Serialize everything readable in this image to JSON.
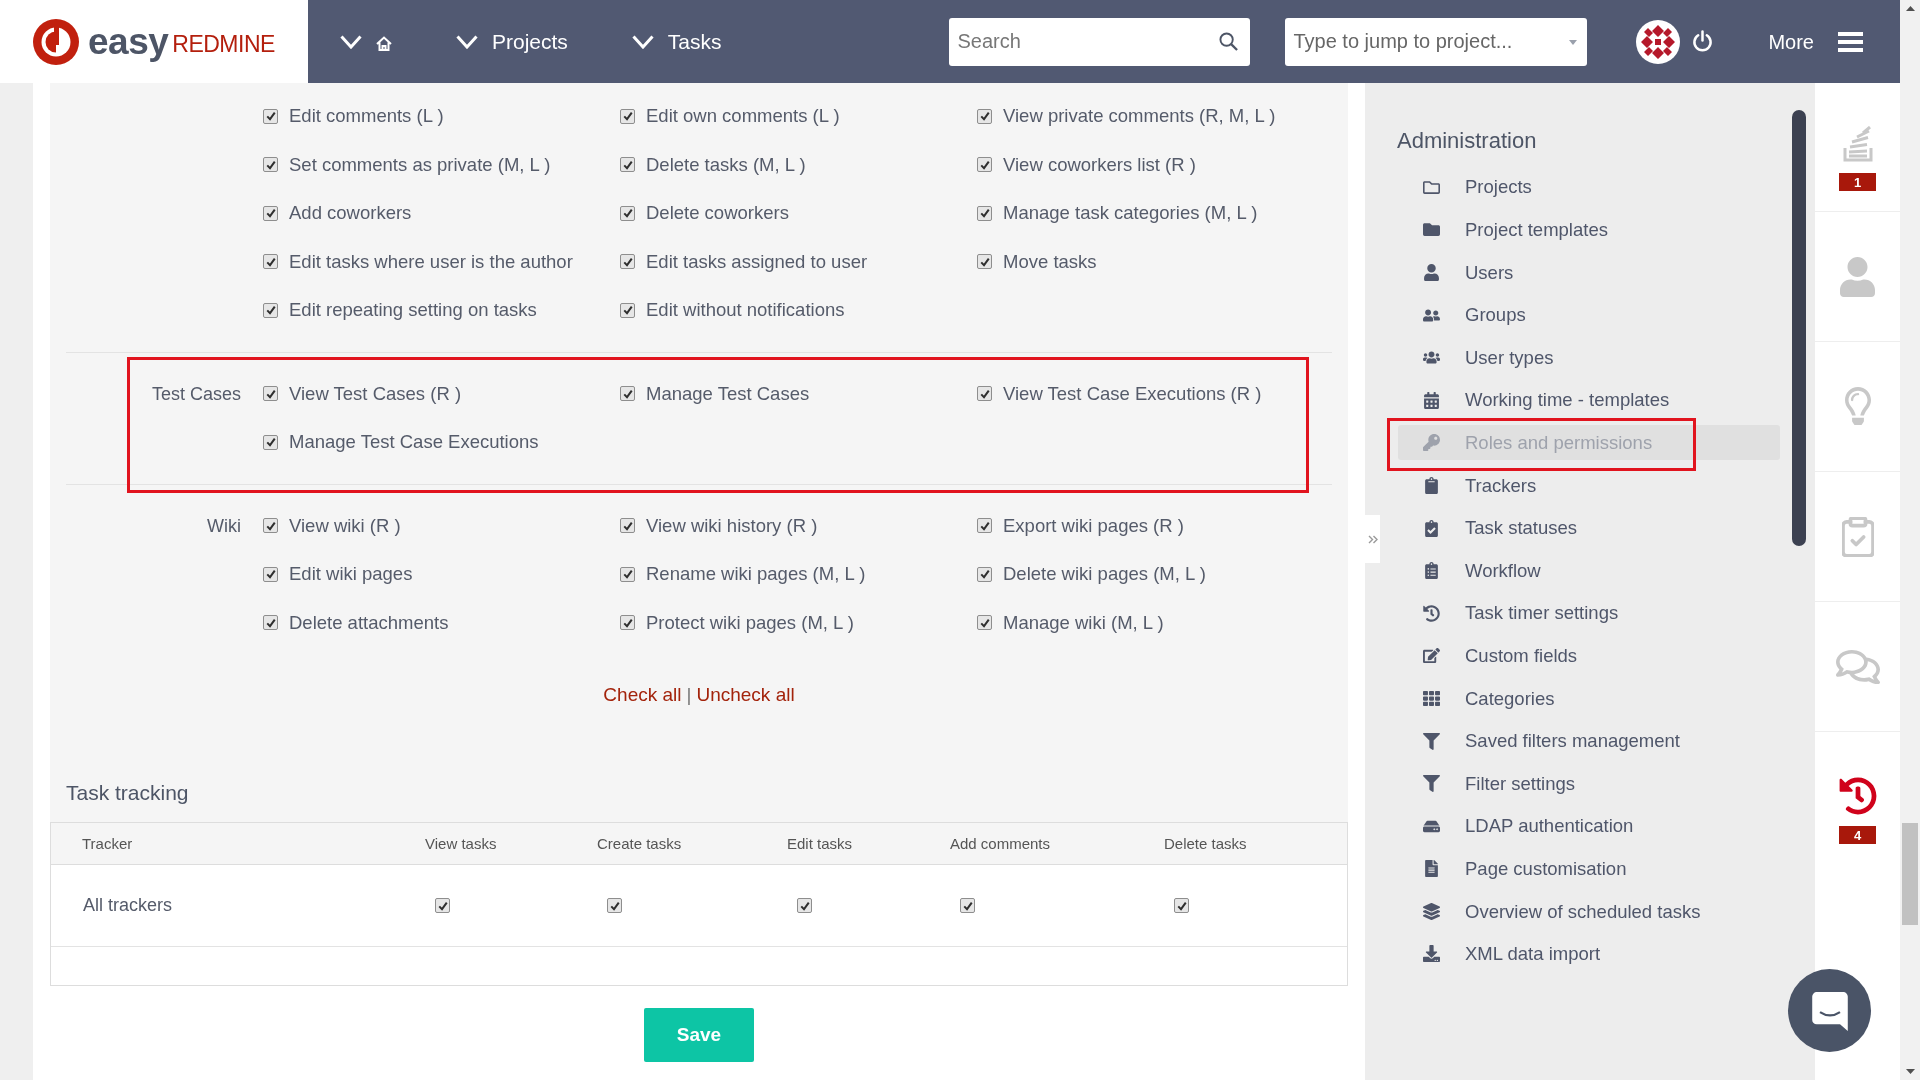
{
  "header": {
    "logo": {
      "text": "easy",
      "suffix": "REDMINE"
    },
    "nav": [
      {
        "kind": "home"
      },
      {
        "kind": "menu",
        "label": "Projects"
      },
      {
        "kind": "menu",
        "label": "Tasks"
      }
    ],
    "search": {
      "placeholder": "Search"
    },
    "project_jump": {
      "placeholder": "Type to jump to project..."
    },
    "more": {
      "label": "More"
    }
  },
  "permissions": {
    "groups": [
      {
        "highlighted": false,
        "items": [
          {
            "label": "Edit comments (L )",
            "checked": true
          },
          {
            "label": "Edit own comments (L )",
            "checked": true
          },
          {
            "label": "View private comments (R, M, L )",
            "checked": true
          },
          {
            "label": "Set comments as private (M, L )",
            "checked": true
          },
          {
            "label": "Delete tasks (M, L )",
            "checked": true
          },
          {
            "label": "View coworkers list (R )",
            "checked": true
          },
          {
            "label": "Add coworkers",
            "checked": true
          },
          {
            "label": "Delete coworkers",
            "checked": true
          },
          {
            "label": "Manage task categories (M, L )",
            "checked": true
          },
          {
            "label": "Edit tasks where user is the author",
            "checked": true
          },
          {
            "label": "Edit tasks assigned to user",
            "checked": true
          },
          {
            "label": "Move tasks",
            "checked": true
          },
          {
            "label": "Edit repeating setting on tasks",
            "checked": true
          },
          {
            "label": "Edit without notifications",
            "checked": true
          }
        ]
      },
      {
        "label": "Test Cases",
        "highlighted": true,
        "items": [
          {
            "label": "View Test Cases (R )",
            "checked": true
          },
          {
            "label": "Manage Test Cases",
            "checked": true
          },
          {
            "label": "View Test Case Executions (R )",
            "checked": true
          },
          {
            "label": "Manage Test Case Executions",
            "checked": true
          }
        ]
      },
      {
        "label": "Wiki",
        "highlighted": false,
        "items": [
          {
            "label": "View wiki (R )",
            "checked": true
          },
          {
            "label": "View wiki history (R )",
            "checked": true
          },
          {
            "label": "Export wiki pages (R )",
            "checked": true
          },
          {
            "label": "Edit wiki pages",
            "checked": true
          },
          {
            "label": "Rename wiki pages (M, L )",
            "checked": true
          },
          {
            "label": "Delete wiki pages (M, L )",
            "checked": true
          },
          {
            "label": "Delete attachments",
            "checked": true
          },
          {
            "label": "Protect wiki pages (M, L )",
            "checked": true
          },
          {
            "label": "Manage wiki (M, L )",
            "checked": true
          }
        ]
      }
    ],
    "check_all": "Check all",
    "separator": "|",
    "uncheck_all": "Uncheck all"
  },
  "task_tracking": {
    "title": "Task tracking",
    "columns": [
      "Tracker",
      "View tasks",
      "Create tasks",
      "Edit tasks",
      "Add comments",
      "Delete tasks"
    ],
    "rows": [
      {
        "tracker": "All trackers",
        "cells": [
          {
            "checked": true
          },
          {
            "checked": true
          },
          {
            "checked": true
          },
          {
            "checked": true
          },
          {
            "checked": true
          }
        ]
      }
    ]
  },
  "save_button": {
    "label": "Save"
  },
  "sidebar": {
    "title": "Administration",
    "items": [
      {
        "label": "Projects",
        "selected": false,
        "highlighted": false
      },
      {
        "label": "Project templates",
        "selected": false,
        "highlighted": false
      },
      {
        "label": "Users",
        "selected": false,
        "highlighted": false
      },
      {
        "label": "Groups",
        "selected": false,
        "highlighted": false
      },
      {
        "label": "User types",
        "selected": false,
        "highlighted": false
      },
      {
        "label": "Working time - templates",
        "selected": false,
        "highlighted": false
      },
      {
        "label": "Roles and permissions",
        "selected": true,
        "highlighted": true
      },
      {
        "label": "Trackers",
        "selected": false,
        "highlighted": false
      },
      {
        "label": "Task statuses",
        "selected": false,
        "highlighted": false
      },
      {
        "label": "Workflow",
        "selected": false,
        "highlighted": false
      },
      {
        "label": "Task timer settings",
        "selected": false,
        "highlighted": false
      },
      {
        "label": "Custom fields",
        "selected": false,
        "highlighted": false
      },
      {
        "label": "Categories",
        "selected": false,
        "highlighted": false
      },
      {
        "label": "Saved filters management",
        "selected": false,
        "highlighted": false
      },
      {
        "label": "Filter settings",
        "selected": false,
        "highlighted": false
      },
      {
        "label": "LDAP authentication",
        "selected": false,
        "highlighted": false
      },
      {
        "label": "Page customisation",
        "selected": false,
        "highlighted": false
      },
      {
        "label": "Overview of scheduled tasks",
        "selected": false,
        "highlighted": false
      },
      {
        "label": "XML data import",
        "selected": false,
        "highlighted": false
      }
    ]
  },
  "right_rail": [
    {
      "kind": "activity",
      "badge": "1"
    },
    {
      "kind": "user"
    },
    {
      "kind": "idea"
    },
    {
      "kind": "checklist"
    },
    {
      "kind": "chat"
    },
    {
      "kind": "timer",
      "badge": "4"
    }
  ]
}
